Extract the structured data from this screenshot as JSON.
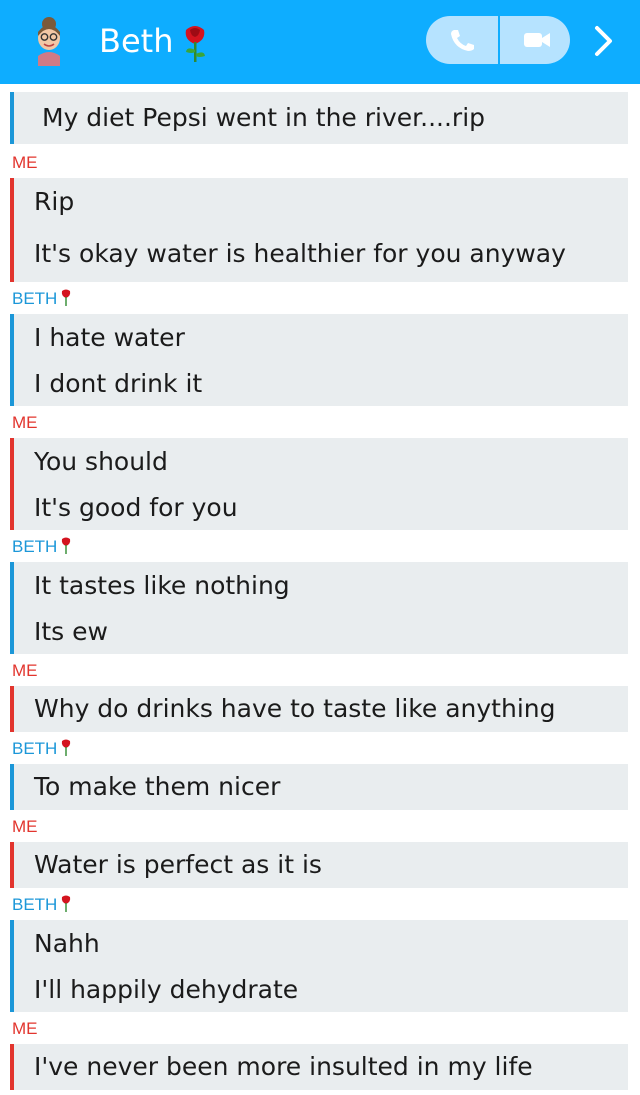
{
  "header": {
    "contact_name": "Beth",
    "name_emoji": "rose-emoji",
    "avatar_icon": "bitmoji-avatar",
    "call_icon": "phone-icon",
    "video_icon": "video-camera-icon",
    "more_icon": "chevron-right-icon",
    "colors": {
      "bar": "#0eadff",
      "buttons": "#b6e3ff"
    }
  },
  "conversation": {
    "first_message": "My diet Pepsi went in the river....rip",
    "groups": [
      {
        "sender": "ME",
        "messages": [
          "Rip",
          "It's okay water is healthier for you anyway"
        ]
      },
      {
        "sender": "BETH",
        "messages": [
          "I hate water",
          "I dont drink it"
        ]
      },
      {
        "sender": "ME",
        "messages": [
          "You should",
          "It's good for you"
        ]
      },
      {
        "sender": "BETH",
        "messages": [
          "It tastes like nothing",
          "Its ew"
        ]
      },
      {
        "sender": "ME",
        "messages": [
          "Why do drinks have to taste like anything"
        ]
      },
      {
        "sender": "BETH",
        "messages": [
          "To make them nicer"
        ]
      },
      {
        "sender": "ME",
        "messages": [
          "Water is perfect as it is"
        ]
      },
      {
        "sender": "BETH",
        "messages": [
          "Nahh",
          "I'll happily dehydrate"
        ]
      },
      {
        "sender": "ME",
        "messages": [
          "I've never been more insulted in my life"
        ]
      }
    ],
    "colors": {
      "me": "#e2352e",
      "beth": "#1c97d8",
      "bubble": "#e9edef"
    }
  }
}
